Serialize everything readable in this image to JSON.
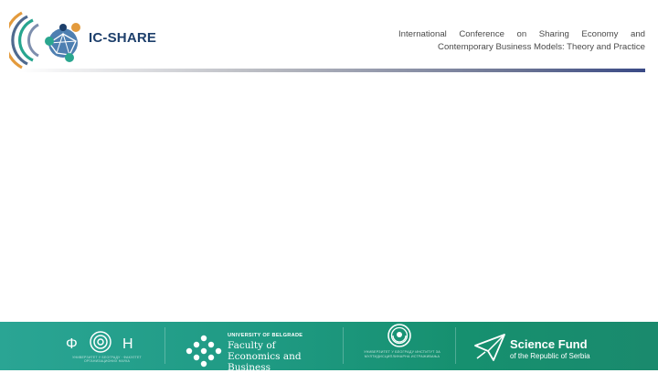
{
  "header": {
    "logo_name": "IC-SHARE",
    "conference_title": "International Conference on Sharing Economy and Contemporary Business Models: Theory and Practice"
  },
  "footer": {
    "fon": {
      "wordmark": "ΦON",
      "caption": "УНИВЕРЗИТЕТ У БЕОГРАДУ · ФАКУЛТЕТ ОРГАНИЗАЦИОНИХ НАУКА"
    },
    "feb": {
      "university": "UNIVERSITY OF BELGRADE",
      "faculty": "Faculty of Economics and Business"
    },
    "center": {
      "caption": "УНИВЕРЗИТЕТ У БЕОГРАДУ ИНСТИТУТ ЗА МУЛТИДИСЦИПЛИНАРНА ИСТРАЖИВАЊА"
    },
    "science_fund": {
      "title": "Science Fund",
      "subtitle": "of the Republic of Serbia"
    }
  },
  "colors": {
    "brand_navy": "#1d3f6b",
    "brand_teal": "#1f9a83",
    "brand_orange": "#e08a3a"
  }
}
